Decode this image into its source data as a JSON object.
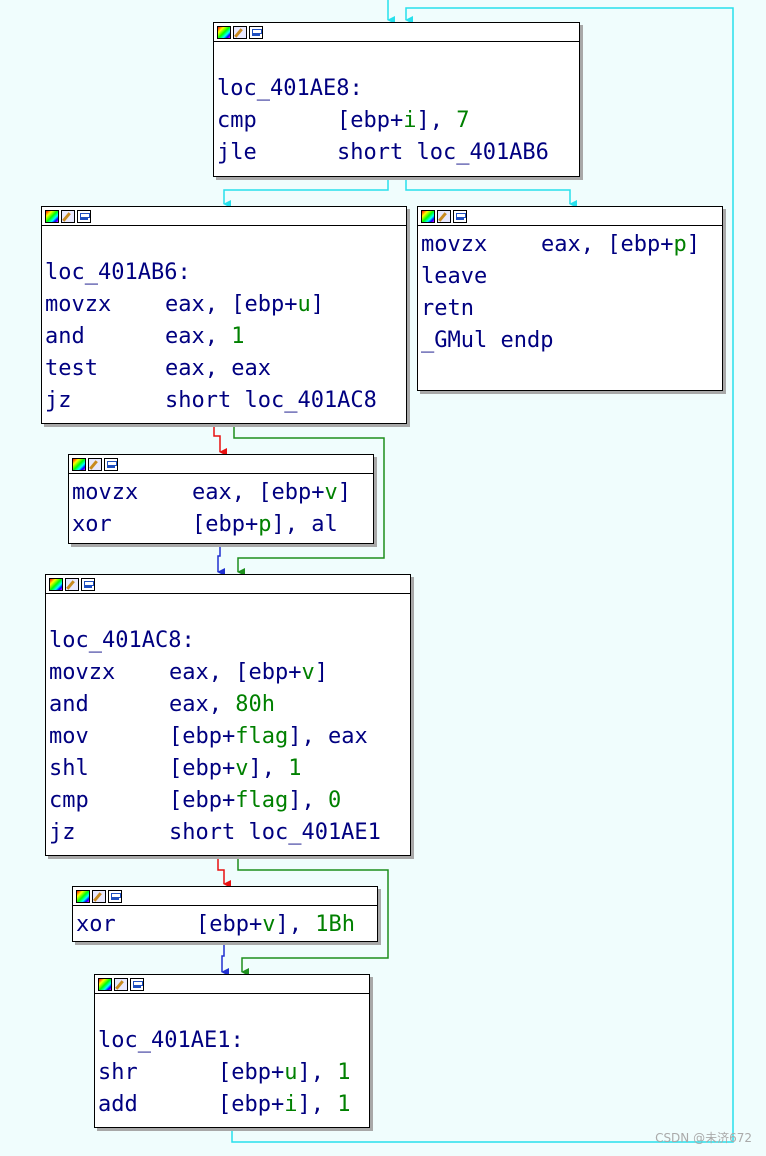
{
  "watermark": "CSDN @未济672",
  "colors": {
    "loop_edge": "#27e0ec",
    "true_edge": "#1d8f1d",
    "false_edge": "#e81010",
    "uncond_edge": "#2030d0",
    "operand_var": "#008000",
    "text": "#000080"
  },
  "header_icons": [
    "color-palette-icon",
    "rename-icon",
    "graph-overview-icon"
  ],
  "blocks": {
    "b1": {
      "label": "loc_401AE8:",
      "lines": [
        {
          "mn": "cmp",
          "ops": [
            {
              "t": "[ebp+"
            },
            {
              "v": "i"
            },
            {
              "t": "], "
            },
            {
              "n": "7"
            }
          ]
        },
        {
          "mn": "jle",
          "ops": [
            {
              "t": "short loc_401AB6"
            }
          ]
        }
      ]
    },
    "b2": {
      "label": "loc_401AB6:",
      "lines": [
        {
          "mn": "movzx",
          "ops": [
            {
              "t": "eax, [ebp+"
            },
            {
              "v": "u"
            },
            {
              "t": "]"
            }
          ]
        },
        {
          "mn": "and",
          "ops": [
            {
              "t": "eax, "
            },
            {
              "n": "1"
            }
          ]
        },
        {
          "mn": "test",
          "ops": [
            {
              "t": "eax, eax"
            }
          ]
        },
        {
          "mn": "jz",
          "ops": [
            {
              "t": "short loc_401AC8"
            }
          ]
        }
      ]
    },
    "b3": {
      "label": "",
      "lines": [
        {
          "mn": "movzx",
          "ops": [
            {
              "t": "eax, [ebp+"
            },
            {
              "v": "p"
            },
            {
              "t": "]"
            }
          ]
        },
        {
          "mn": "leave",
          "ops": []
        },
        {
          "mn": "retn",
          "ops": []
        },
        {
          "mn": "_GMul endp",
          "ops": []
        }
      ]
    },
    "b4": {
      "label": "",
      "lines": [
        {
          "mn": "movzx",
          "ops": [
            {
              "t": "eax, [ebp+"
            },
            {
              "v": "v"
            },
            {
              "t": "]"
            }
          ]
        },
        {
          "mn": "xor",
          "ops": [
            {
              "t": "[ebp+"
            },
            {
              "v": "p"
            },
            {
              "t": "], al"
            }
          ]
        }
      ]
    },
    "b5": {
      "label": "loc_401AC8:",
      "lines": [
        {
          "mn": "movzx",
          "ops": [
            {
              "t": "eax, [ebp+"
            },
            {
              "v": "v"
            },
            {
              "t": "]"
            }
          ]
        },
        {
          "mn": "and",
          "ops": [
            {
              "t": "eax, "
            },
            {
              "n": "80h"
            }
          ]
        },
        {
          "mn": "mov",
          "ops": [
            {
              "t": "[ebp+"
            },
            {
              "v": "flag"
            },
            {
              "t": "], eax"
            }
          ]
        },
        {
          "mn": "shl",
          "ops": [
            {
              "t": "[ebp+"
            },
            {
              "v": "v"
            },
            {
              "t": "], "
            },
            {
              "n": "1"
            }
          ]
        },
        {
          "mn": "cmp",
          "ops": [
            {
              "t": "[ebp+"
            },
            {
              "v": "flag"
            },
            {
              "t": "], "
            },
            {
              "n": "0"
            }
          ]
        },
        {
          "mn": "jz",
          "ops": [
            {
              "t": "short loc_401AE1"
            }
          ]
        }
      ]
    },
    "b6": {
      "label": "",
      "lines": [
        {
          "mn": "xor",
          "ops": [
            {
              "t": "[ebp+"
            },
            {
              "v": "v"
            },
            {
              "t": "], "
            },
            {
              "n": "1Bh"
            }
          ]
        }
      ]
    },
    "b7": {
      "label": "loc_401AE1:",
      "lines": [
        {
          "mn": "shr",
          "ops": [
            {
              "t": "[ebp+"
            },
            {
              "v": "u"
            },
            {
              "t": "], "
            },
            {
              "n": "1"
            }
          ]
        },
        {
          "mn": "add",
          "ops": [
            {
              "t": "[ebp+"
            },
            {
              "v": "i"
            },
            {
              "t": "], "
            },
            {
              "n": "1"
            }
          ]
        }
      ]
    }
  }
}
